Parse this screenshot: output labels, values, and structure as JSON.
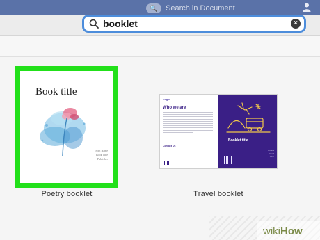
{
  "app": {
    "accent_color": "#4d8ddb",
    "menubar_color": "#5a72a8"
  },
  "menubar": {
    "ghost_search_placeholder": "Search in Document",
    "user_icon": "person-icon"
  },
  "search": {
    "value": "booklet",
    "search_icon": "magnifier-icon",
    "clear_icon": "clear-icon"
  },
  "templates": [
    {
      "name": "Poetry booklet",
      "selected": true,
      "highlight_color": "#22e01a",
      "thumb": {
        "title": "Book title",
        "meta": [
          "Poet Name",
          "Book Title",
          "Publisher"
        ]
      }
    },
    {
      "name": "Travel booklet",
      "selected": false,
      "thumb": {
        "left_heading": "Who we are",
        "left_logo": "Logo",
        "left_contact": "Contact Us",
        "right_title": "Booklet title",
        "right_meta": [
          "Phone",
          "Email",
          "Web"
        ],
        "panel_color": "#3a1f86"
      }
    }
  ],
  "watermark": {
    "part1": "wiki",
    "part2": "How"
  }
}
